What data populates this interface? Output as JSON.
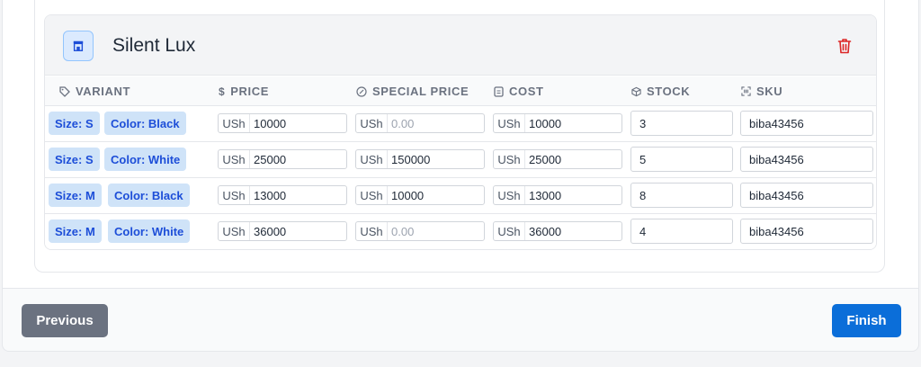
{
  "product": {
    "title": "Silent Lux",
    "icon": "store-icon",
    "delete_icon": "trash-icon"
  },
  "columns": {
    "variant": "VARIANT",
    "price": "PRICE",
    "special_price": "SPECIAL PRICE",
    "cost": "COST",
    "stock": "STOCK",
    "sku": "SKU"
  },
  "currency": "USh",
  "special_price_placeholder": "0.00",
  "rows": [
    {
      "size": "Size: S",
      "color": "Color: Black",
      "price": "10000",
      "special_price": "",
      "cost": "10000",
      "stock": "3",
      "sku": "biba43456"
    },
    {
      "size": "Size: S",
      "color": "Color: White",
      "price": "25000",
      "special_price": "150000",
      "cost": "25000",
      "stock": "5",
      "sku": "biba43456"
    },
    {
      "size": "Size: M",
      "color": "Color: Black",
      "price": "13000",
      "special_price": "10000",
      "cost": "13000",
      "stock": "8",
      "sku": "biba43456"
    },
    {
      "size": "Size: M",
      "color": "Color: White",
      "price": "36000",
      "special_price": "",
      "cost": "36000",
      "stock": "4",
      "sku": "biba43456"
    }
  ],
  "footer": {
    "previous_label": "Previous",
    "finish_label": "Finish"
  },
  "colors": {
    "accent": "#0b6ed9",
    "badge_bg": "#cfe3f8",
    "badge_text": "#1d4ed8",
    "danger": "#dc2626",
    "secondary_button": "#6b7280"
  }
}
